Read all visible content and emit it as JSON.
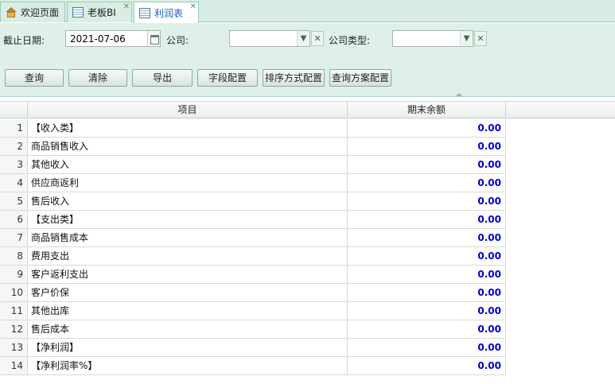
{
  "tabs": [
    {
      "label": "欢迎页面",
      "icon": "home-icon"
    },
    {
      "label": "老板BI",
      "icon": "grid-icon"
    },
    {
      "label": "利润表",
      "icon": "grid-icon"
    }
  ],
  "filters": {
    "date_label": "截止日期:",
    "date_value": "2021-07-06",
    "company_label": "公司:",
    "company_value": "",
    "company_type_label": "公司类型:",
    "company_type_value": ""
  },
  "buttons": {
    "query": "查询",
    "clear": "清除",
    "export": "导出",
    "field_config": "字段配置",
    "sort_config": "排序方式配置",
    "query_plan_config": "查询方案配置"
  },
  "table": {
    "headers": {
      "item": "项目",
      "balance": "期末余额"
    },
    "rows": [
      {
        "num": "1",
        "item": "【收入类】",
        "value": "0.00"
      },
      {
        "num": "2",
        "item": "商品销售收入",
        "value": "0.00"
      },
      {
        "num": "3",
        "item": "其他收入",
        "value": "0.00"
      },
      {
        "num": "4",
        "item": "供应商返利",
        "value": "0.00"
      },
      {
        "num": "5",
        "item": "售后收入",
        "value": "0.00"
      },
      {
        "num": "6",
        "item": "【支出类】",
        "value": "0.00"
      },
      {
        "num": "7",
        "item": "商品销售成本",
        "value": "0.00"
      },
      {
        "num": "8",
        "item": "费用支出",
        "value": "0.00"
      },
      {
        "num": "9",
        "item": "客户返利支出",
        "value": "0.00"
      },
      {
        "num": "10",
        "item": "客户价保",
        "value": "0.00"
      },
      {
        "num": "11",
        "item": "其他出库",
        "value": "0.00"
      },
      {
        "num": "12",
        "item": "售后成本",
        "value": "0.00"
      },
      {
        "num": "13",
        "item": "【净利润】",
        "value": "0.00"
      },
      {
        "num": "14",
        "item": "【净利润率%】",
        "value": "0.00"
      }
    ]
  },
  "colors": {
    "value_text": "#0000cc",
    "active_tab_text": "#1d64c5",
    "toolbar_bg": "#dff0e8"
  }
}
